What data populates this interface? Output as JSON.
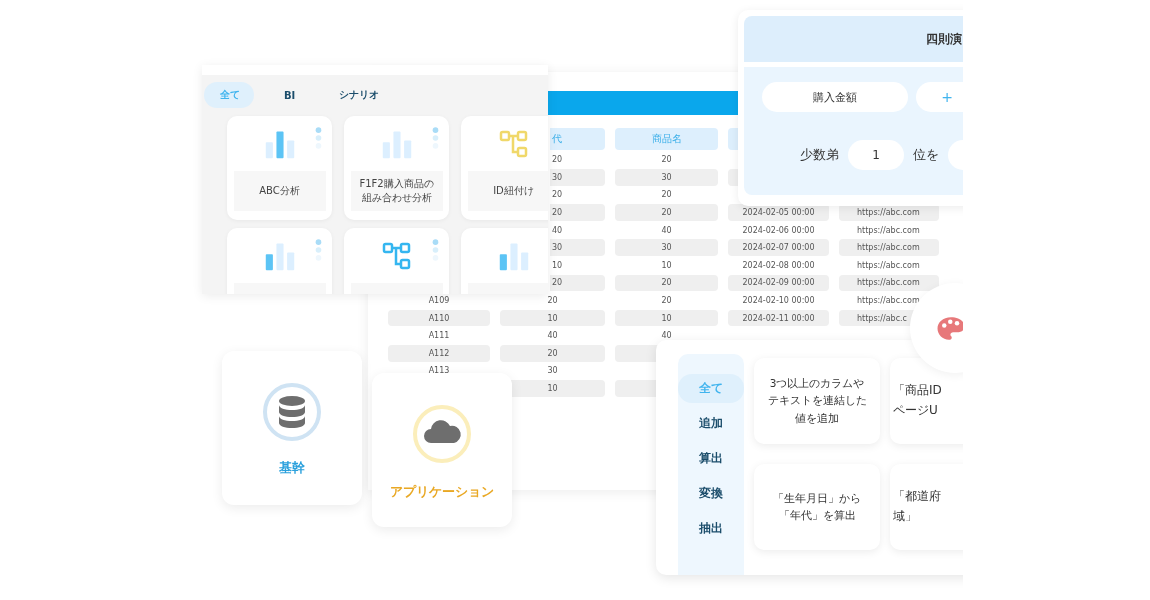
{
  "analysis_panel": {
    "tabs": [
      {
        "label": "全て",
        "selected": true
      },
      {
        "label": "BI",
        "selected": false
      },
      {
        "label": "シナリオ",
        "selected": false
      }
    ],
    "cards": [
      {
        "kind": "midchart",
        "dots": true,
        "lines": [
          "ABC分析"
        ]
      },
      {
        "kind": "palechart",
        "dots": true,
        "lines": [
          "F1F2購入商品の",
          "組み合わせ分析"
        ]
      },
      {
        "kind": "flow",
        "color": "#f0d86a",
        "dots": false,
        "lines": [
          "ID紐付け"
        ]
      },
      {
        "kind": "leftchart",
        "dots": true
      },
      {
        "kind": "flow",
        "color": "#35b6f0",
        "dots": true
      },
      {
        "kind": "leftchart",
        "dots": false
      }
    ]
  },
  "table": {
    "columns": [
      null,
      "代",
      "商品名",
      null,
      null
    ],
    "rows": [
      [
        null,
        "20",
        "20",
        null,
        null
      ],
      [
        null,
        "30",
        "30",
        null,
        null
      ],
      [
        null,
        "20",
        "20",
        null,
        null
      ],
      [
        null,
        "20",
        "20",
        "2024-02-05 00:00",
        "https://abc.com"
      ],
      [
        null,
        "40",
        "40",
        "2024-02-06 00:00",
        "https://abc.com"
      ],
      [
        null,
        "30",
        "30",
        "2024-02-07 00:00",
        "https://abc.com"
      ],
      [
        null,
        "10",
        "10",
        "2024-02-08 00:00",
        "https://abc.com"
      ],
      [
        null,
        "20",
        "20",
        "2024-02-09 00:00",
        "https://abc.com"
      ],
      [
        "A109",
        "20",
        "20",
        "2024-02-10 00:00",
        "https://abc.com"
      ],
      [
        "A110",
        "10",
        "10",
        "2024-02-11 00:00",
        "https://abc.c"
      ],
      [
        "A111",
        "40",
        "40",
        null,
        null
      ],
      [
        "A112",
        "20",
        null,
        null,
        null
      ],
      [
        "A113",
        "30",
        null,
        null,
        null
      ],
      [
        null,
        "10",
        null,
        null,
        null
      ]
    ]
  },
  "formula_panel": {
    "title": "四則演",
    "operand": "購入金額",
    "operator": "+",
    "prefix": "少数弟",
    "digits": "1",
    "suffix": "位を"
  },
  "categories": [
    {
      "label": "基幹",
      "color": "#2aa0dc"
    },
    {
      "label": "アプリケーション",
      "color": "#e9a824"
    }
  ],
  "process_panel": {
    "sidebar": [
      {
        "label": "全て",
        "selected": true
      },
      {
        "label": "追加",
        "selected": false
      },
      {
        "label": "算出",
        "selected": false
      },
      {
        "label": "変換",
        "selected": false
      },
      {
        "label": "抽出",
        "selected": false
      }
    ],
    "cards": [
      [
        "3つ以上のカラムや",
        "テキストを連結した",
        "値を追加"
      ],
      [
        "「商品ID",
        "ページU"
      ],
      [
        "「生年月日」から",
        "「年代」を算出"
      ],
      [
        "「都道府",
        "域」"
      ]
    ]
  }
}
